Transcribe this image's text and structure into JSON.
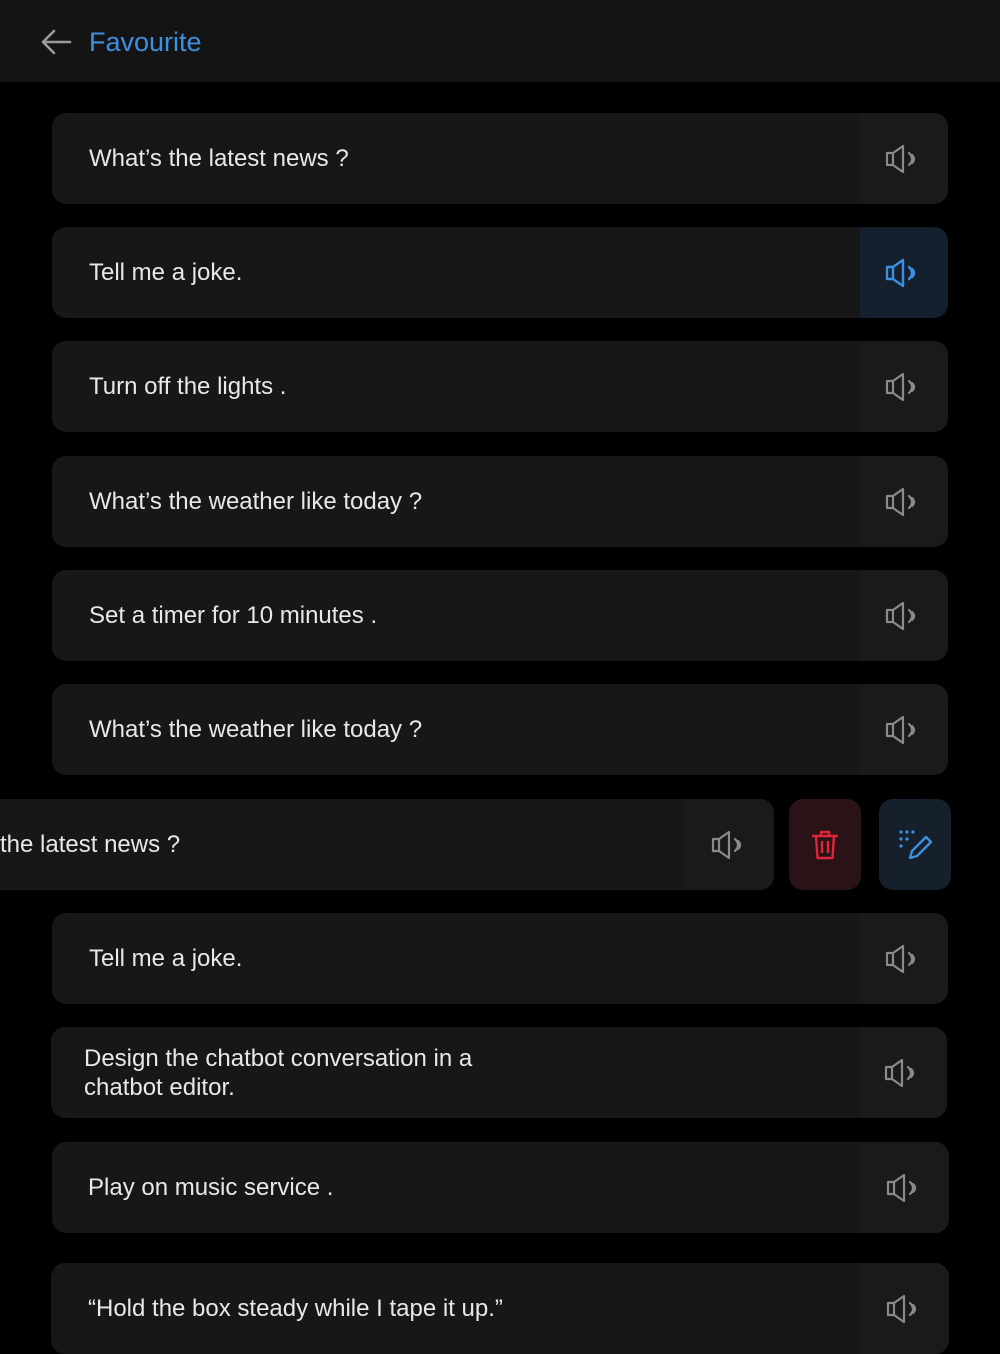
{
  "header": {
    "title": "Favourite"
  },
  "colors": {
    "accent": "#3d8fe0",
    "danger": "#e0243a",
    "icon_idle": "#8a8a8a"
  },
  "items": [
    {
      "text": "What’s the latest news ?",
      "icon": "speaker-icon"
    },
    {
      "text": "Tell me a joke.",
      "icon": "speaker-icon",
      "active": true
    },
    {
      "text": "Turn off the lights .",
      "icon": "speaker-icon"
    },
    {
      "text": "What’s the weather like today ?",
      "icon": "speaker-icon"
    },
    {
      "text": "Set a timer for 10 minutes .",
      "icon": "speaker-icon"
    },
    {
      "text": "What’s the weather like today ?",
      "icon": "speaker-icon"
    },
    {
      "text": "the latest news ?",
      "icon": "speaker-icon",
      "swiped": true,
      "actions": [
        "trash-icon",
        "edit-pen-icon"
      ]
    },
    {
      "text": "Tell me a joke.",
      "icon": "speaker-icon"
    },
    {
      "text": "Design the chatbot conversation in a\nchatbot editor.",
      "icon": "speaker-icon"
    },
    {
      "text": "Play on music  service .",
      "icon": "speaker-icon"
    },
    {
      "text": "“Hold the box steady while I tape it up.”",
      "icon": "speaker-icon"
    }
  ]
}
